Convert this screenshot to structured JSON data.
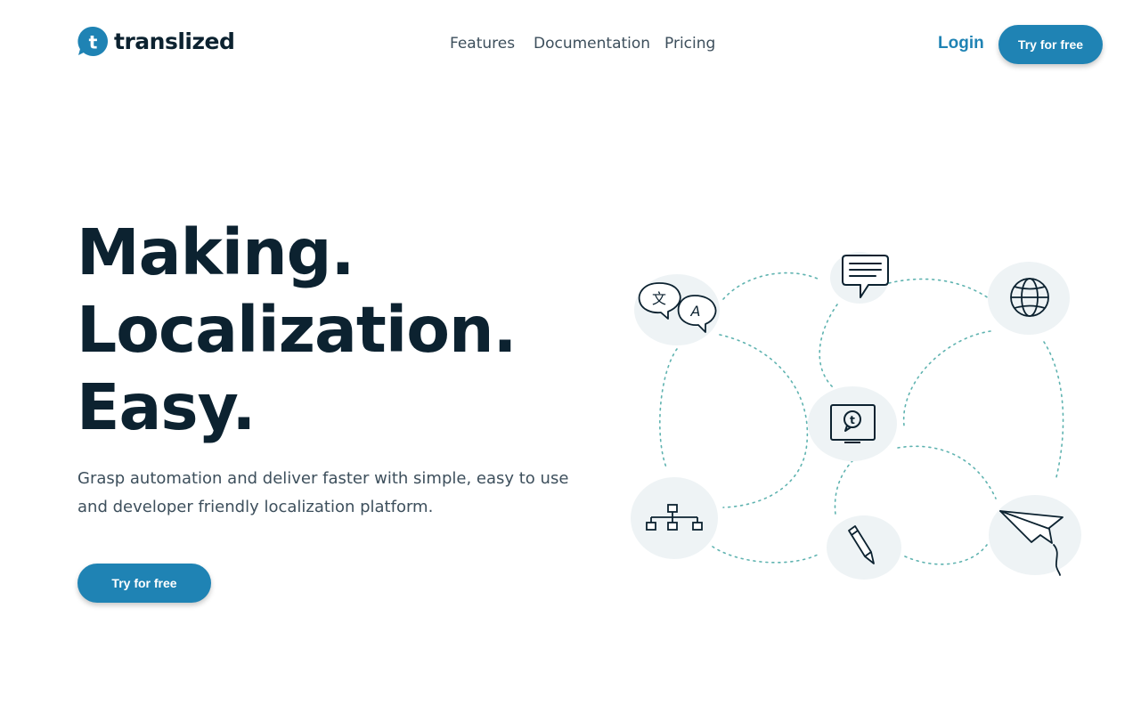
{
  "brand": {
    "name": "translized",
    "logo_letter": "t",
    "color": "#1f83b4"
  },
  "nav": {
    "features": "Features",
    "documentation": "Documentation",
    "pricing": "Pricing"
  },
  "header": {
    "login": "Login",
    "cta": "Try for free"
  },
  "hero": {
    "title_line1": "Making.",
    "title_line2": "Localization.",
    "title_line3": "Easy.",
    "subtitle": "Grasp automation and deliver faster with simple, easy to use and developer friendly localization platform.",
    "cta": "Try for free"
  },
  "illustration": {
    "icons": [
      "translate-bubbles-icon",
      "chat-message-icon",
      "globe-icon",
      "translized-screen-icon",
      "sitemap-icon",
      "pencil-icon",
      "paper-plane-icon"
    ],
    "translate_glyphs": [
      "文",
      "A"
    ],
    "screen_letter": "t"
  },
  "colors": {
    "accent": "#1f83b4",
    "text": "#0c2230",
    "muted": "#3d4f5c",
    "node_bg": "#eef3f5",
    "dots": "#5fb3b0"
  }
}
